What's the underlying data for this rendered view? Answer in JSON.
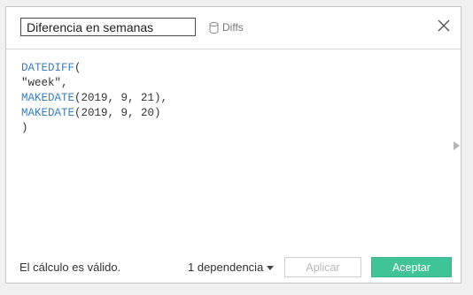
{
  "dialog": {
    "name_value": "Diferencia en semanas",
    "diffs_label": "Diffs",
    "formula_lines": [
      {
        "kw": "DATEDIFF",
        "rest": "("
      },
      {
        "kw": "",
        "rest": "\"week\","
      },
      {
        "kw": "MAKEDATE",
        "rest": "(2019, 9, 21),"
      },
      {
        "kw": "MAKEDATE",
        "rest": "(2019, 9, 20)"
      },
      {
        "kw": "",
        "rest": ")"
      }
    ],
    "status_text": "El cálculo es válido.",
    "dependency_label": "1 dependencia",
    "apply_label": "Aplicar",
    "accept_label": "Aceptar"
  },
  "icons": {
    "diffs": "cylinder-icon",
    "close": "close-icon",
    "dependency": "caret-down-icon",
    "scroll": "expand-arrow-icon"
  },
  "colors": {
    "keyword": "#3a7fbf",
    "accept_bg": "#3ec497",
    "disabled_text": "#b9b9b9"
  }
}
